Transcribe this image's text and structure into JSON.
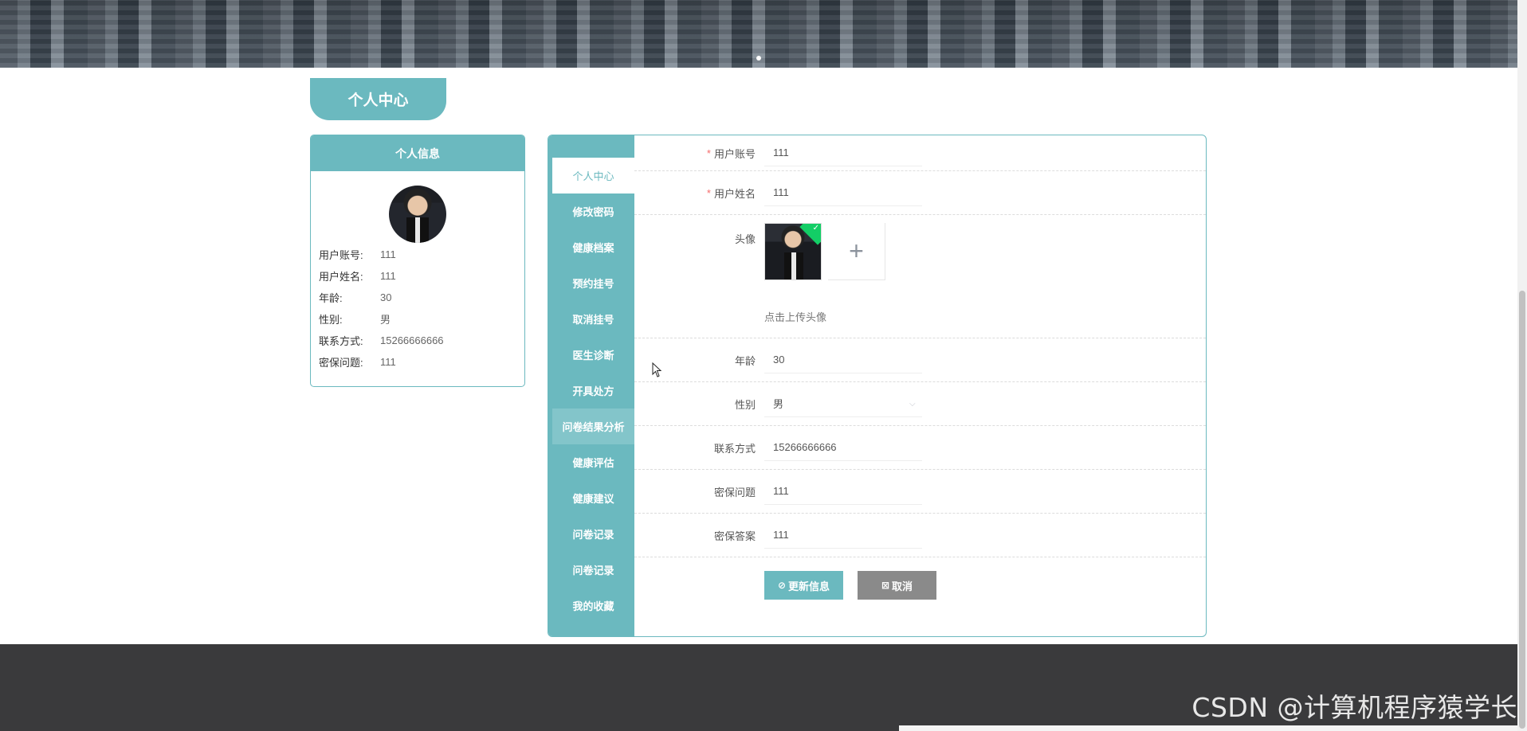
{
  "banner": {
    "carousel_dots": 1
  },
  "page_title": "个人中心",
  "info_card": {
    "header": "个人信息",
    "rows": [
      {
        "label": "用户账号:",
        "value": "111"
      },
      {
        "label": "用户姓名:",
        "value": "111"
      },
      {
        "label": "年龄:",
        "value": "30"
      },
      {
        "label": "性别:",
        "value": "男"
      },
      {
        "label": "联系方式:",
        "value": "15266666666"
      },
      {
        "label": "密保问题:",
        "value": "111"
      }
    ]
  },
  "menu": {
    "items": [
      {
        "label": "个人中心",
        "active": true
      },
      {
        "label": "修改密码"
      },
      {
        "label": "健康档案"
      },
      {
        "label": "预约挂号"
      },
      {
        "label": "取消挂号"
      },
      {
        "label": "医生诊断"
      },
      {
        "label": "开具处方"
      },
      {
        "label": "问卷结果分析",
        "hover": true
      },
      {
        "label": "健康评估"
      },
      {
        "label": "健康建议"
      },
      {
        "label": "问卷记录"
      },
      {
        "label": "问卷记录"
      },
      {
        "label": "我的收藏"
      }
    ]
  },
  "form": {
    "account": {
      "label": "用户账号",
      "required_mark": "*",
      "value": "111"
    },
    "name": {
      "label": "用户姓名",
      "required_mark": "*",
      "value": "111"
    },
    "avatar": {
      "label": "头像",
      "add_icon": "plus-icon",
      "hint": "点击上传头像",
      "status_icon": "check-icon"
    },
    "age": {
      "label": "年龄",
      "value": "30"
    },
    "gender": {
      "label": "性别",
      "value": "男",
      "arrow_icon": "chevron-down-icon"
    },
    "phone": {
      "label": "联系方式",
      "value": "15266666666"
    },
    "security_question": {
      "label": "密保问题",
      "value": "111"
    },
    "security_answer": {
      "label": "密保答案",
      "value": "111"
    }
  },
  "buttons": {
    "update": {
      "label": "更新信息",
      "icon": "check-circle-icon"
    },
    "cancel": {
      "label": "取消",
      "icon": "close-square-icon"
    }
  },
  "watermark": "CSDN @计算机程序猿学长",
  "colors": {
    "accent": "#6bb9bf",
    "footer": "#3a3a3c",
    "cancel": "#8a8a8a",
    "required": "#f56c6c",
    "success": "#13ce66"
  }
}
